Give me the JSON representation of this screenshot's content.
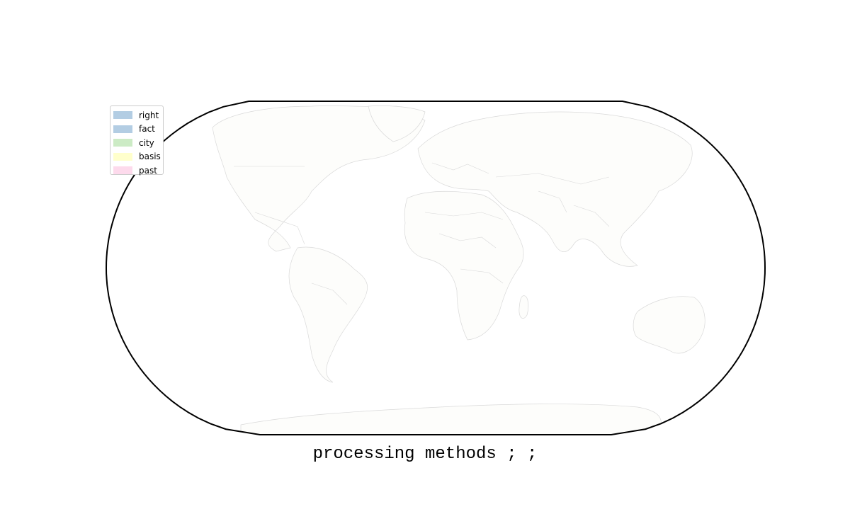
{
  "title": "processing methods ; ;",
  "legend": [
    {
      "label": "right",
      "color": "#b3cde3"
    },
    {
      "label": "fact",
      "color": "#b3cde3"
    },
    {
      "label": "city",
      "color": "#ccebc5"
    },
    {
      "label": "basis",
      "color": "#ffffcc"
    },
    {
      "label": "past",
      "color": "#fddaec"
    }
  ],
  "map": {
    "projection": "Robinson",
    "land_color": "#fdfdfb",
    "border_color": "#d9d9d9",
    "frame_color": "#000000"
  }
}
